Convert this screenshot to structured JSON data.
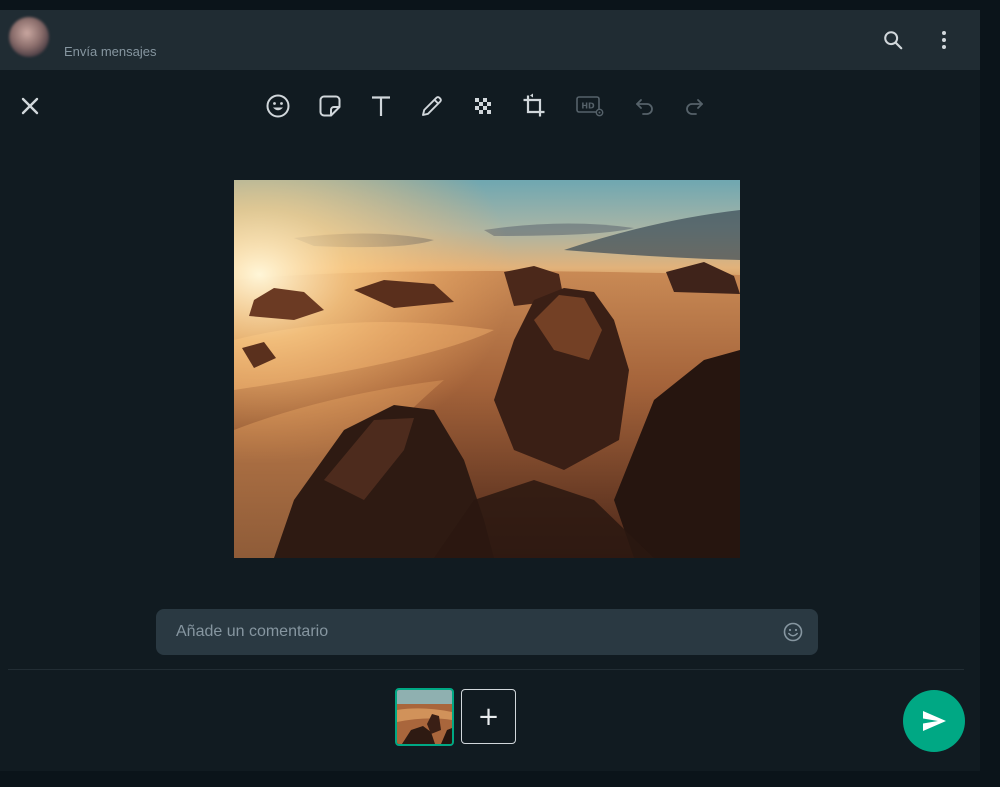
{
  "header": {
    "subtitle": "Envía mensajes",
    "icons": [
      "search-icon",
      "menu-dots-icon"
    ]
  },
  "toolbar": {
    "tools": [
      "close-icon",
      "emoji-icon",
      "sticker-icon",
      "text-icon",
      "pencil-icon",
      "blur-icon",
      "crop-icon",
      "hd-icon",
      "undo-icon",
      "redo-icon"
    ]
  },
  "composer": {
    "placeholder": "Añade un comentario",
    "emoji_icon": "emoji-icon"
  },
  "footer": {
    "add_label": "+",
    "send_icon": "send-icon"
  },
  "colors": {
    "accent": "#00a884",
    "background": "#111b21",
    "header": "#202c33",
    "input": "#2a3942",
    "icon": "#aebac1"
  }
}
